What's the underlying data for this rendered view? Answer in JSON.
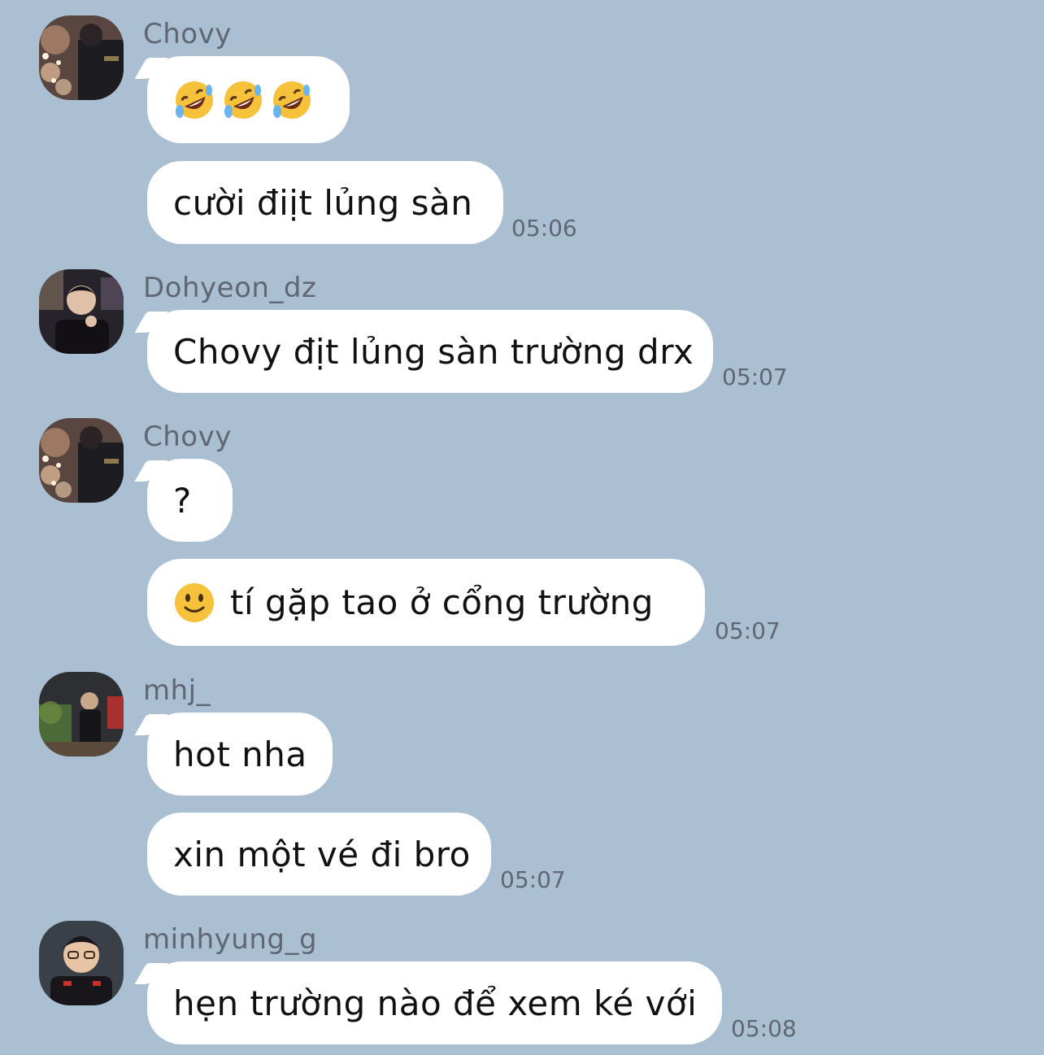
{
  "colors": {
    "background": "#abbfd3",
    "bubble": "#ffffff",
    "meta_text": "#5e6772"
  },
  "messages": [
    {
      "sender": "Chovy",
      "avatar": "chovy-avatar",
      "bubbles": [
        {
          "text": "",
          "emojis": [
            "rofl",
            "rofl",
            "rofl"
          ]
        },
        {
          "text": "cười điịt lủng sàn",
          "time": "05:06"
        }
      ]
    },
    {
      "sender": "Dohyeon_dz",
      "avatar": "dohyeon-avatar",
      "bubbles": [
        {
          "text": "Chovy địt lủng sàn trường drx",
          "time": "05:07"
        }
      ]
    },
    {
      "sender": "Chovy",
      "avatar": "chovy-avatar",
      "bubbles": [
        {
          "text": "?"
        },
        {
          "text": "tí gặp tao ở cổng trường",
          "emojis": [
            "slightly-smiling-face"
          ],
          "time": "05:07"
        }
      ]
    },
    {
      "sender": "mhj_",
      "avatar": "mhj-avatar",
      "bubbles": [
        {
          "text": "hot nha"
        },
        {
          "text": "xin một vé đi bro",
          "time": "05:07"
        }
      ]
    },
    {
      "sender": "minhyung_g",
      "avatar": "minhyung-avatar",
      "bubbles": [
        {
          "text": "hẹn trường nào để xem ké với",
          "time": "05:08"
        }
      ]
    }
  ]
}
